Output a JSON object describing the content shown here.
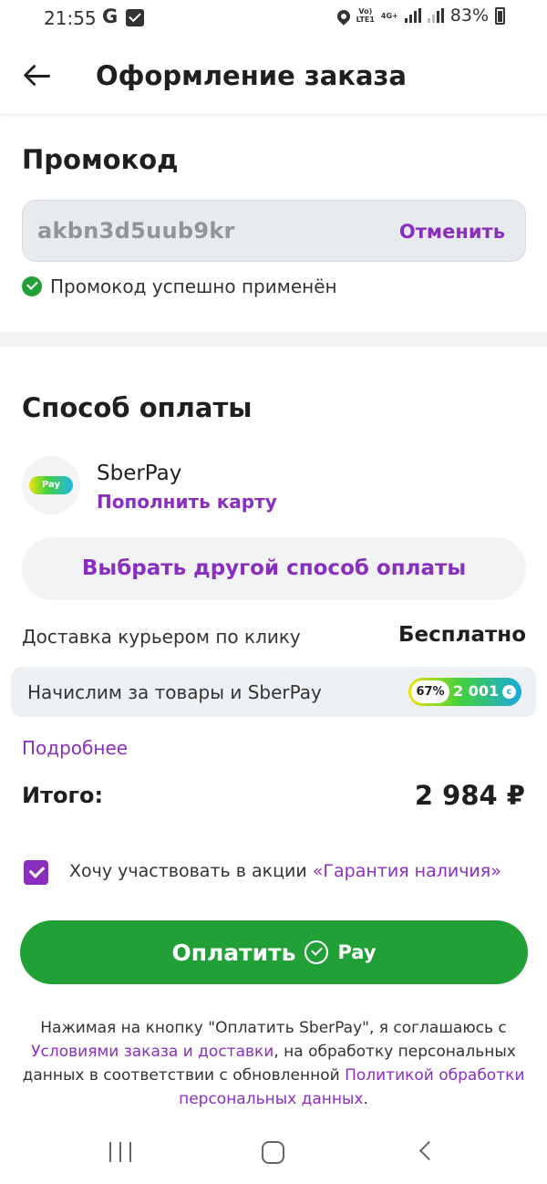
{
  "status_bar": {
    "time": "21:55",
    "g_label": "G",
    "network_top": "Vo)",
    "network_bottom": "LTE1",
    "network_4g": "4G+",
    "battery": "83%"
  },
  "header": {
    "title": "Оформление заказа"
  },
  "promo": {
    "title": "Промокод",
    "code": "akbn3d5uub9kr",
    "cancel_label": "Отменить",
    "status": "Промокод успешно применён"
  },
  "payment": {
    "title": "Способ оплаты",
    "method_name": "SberPay",
    "logo_text": "Pay",
    "topup_label": "Пополнить карту",
    "other_method_label": "Выбрать другой способ оплаты"
  },
  "delivery": {
    "label": "Доставка курьером по клику",
    "value": "Бесплатно"
  },
  "bonus": {
    "label": "Начислим за товары и SberPay",
    "percent": "67%",
    "amount": "2 001",
    "coin_symbol": "с"
  },
  "more_link": "Подробнее",
  "total": {
    "label": "Итого:",
    "value": "2 984 ₽"
  },
  "guarantee": {
    "text": "Хочу участвовать в акции",
    "link": "«Гарантия наличия»",
    "checked": true
  },
  "pay_button": {
    "label": "Оплатить",
    "suffix": "Pay"
  },
  "legal": {
    "part1": "Нажимая на кнопку \"Оплатить SberPay\", я соглашаюсь с",
    "link1": "Условиями заказа и доставки",
    "part2": ", на обработку персональных данных в соответствии с обновленной",
    "link2": "Политикой обработки персональных данных",
    "part3": "."
  },
  "colors": {
    "accent": "#8a2fbd",
    "primary_green": "#21a038",
    "field_bg": "#e8ebee"
  }
}
